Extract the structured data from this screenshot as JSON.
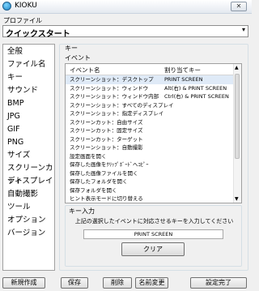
{
  "window": {
    "title": "KIOKU",
    "close_label": "✕"
  },
  "profile": {
    "label": "プロファイル",
    "value": "クイックスタート",
    "arrow": "▾"
  },
  "sidebar": {
    "items": [
      "全般",
      "ファイル名",
      "キー",
      "サウンド",
      "BMP",
      "JPG",
      "GIF",
      "PNG",
      "サイズ",
      "スクリーンカット",
      "ディスプレイ",
      "自動撮影",
      "ツール",
      "オプション",
      "バージョン"
    ]
  },
  "key_group": {
    "title": "キー",
    "event_label": "イベント",
    "columns": {
      "event": "イベント名",
      "assigned": "割り当てキー"
    },
    "rows": [
      {
        "event": "スクリーンショット：デスクトップ",
        "key": "PRINT SCREEN"
      },
      {
        "event": "スクリーンショット：ウィンドウ",
        "key": "Alt(右) & PRINT SCREEN"
      },
      {
        "event": "スクリーンショット：ウィンドウ内部",
        "key": "Ctrl(右) & PRINT SCREEN"
      },
      {
        "event": "スクリーンショット：すべてのディスプレイ",
        "key": ""
      },
      {
        "event": "スクリーンショット：指定ディスプレイ",
        "key": ""
      },
      {
        "event": "スクリーンカット：自由サイズ",
        "key": ""
      },
      {
        "event": "スクリーンカット：固定サイズ",
        "key": ""
      },
      {
        "event": "スクリーンカット：ターゲット",
        "key": ""
      },
      {
        "event": "スクリーンショット：自動撮影",
        "key": ""
      },
      {
        "event": "設定画面を開く",
        "key": ""
      },
      {
        "event": "保存した画像をｸﾘｯﾌﾟﾎﾞｰﾄﾞへｺﾋﾟｰ",
        "key": ""
      },
      {
        "event": "保存した画像ファイルを開く",
        "key": ""
      },
      {
        "event": "保存したフォルダを開く",
        "key": ""
      },
      {
        "event": "保存フォルダを開く",
        "key": ""
      },
      {
        "event": "ヒント表示モードに切り替える",
        "key": ""
      }
    ],
    "selected_index": 0
  },
  "key_input": {
    "title": "キー入力",
    "description": "上記の選択したイベントに対応させるキーを入力してください",
    "value": "PRINT SCREEN",
    "clear_label": "クリア"
  },
  "buttons": {
    "new": "新規作成",
    "save": "保存",
    "delete": "削除",
    "rename": "名前変更",
    "done": "設定完了"
  }
}
